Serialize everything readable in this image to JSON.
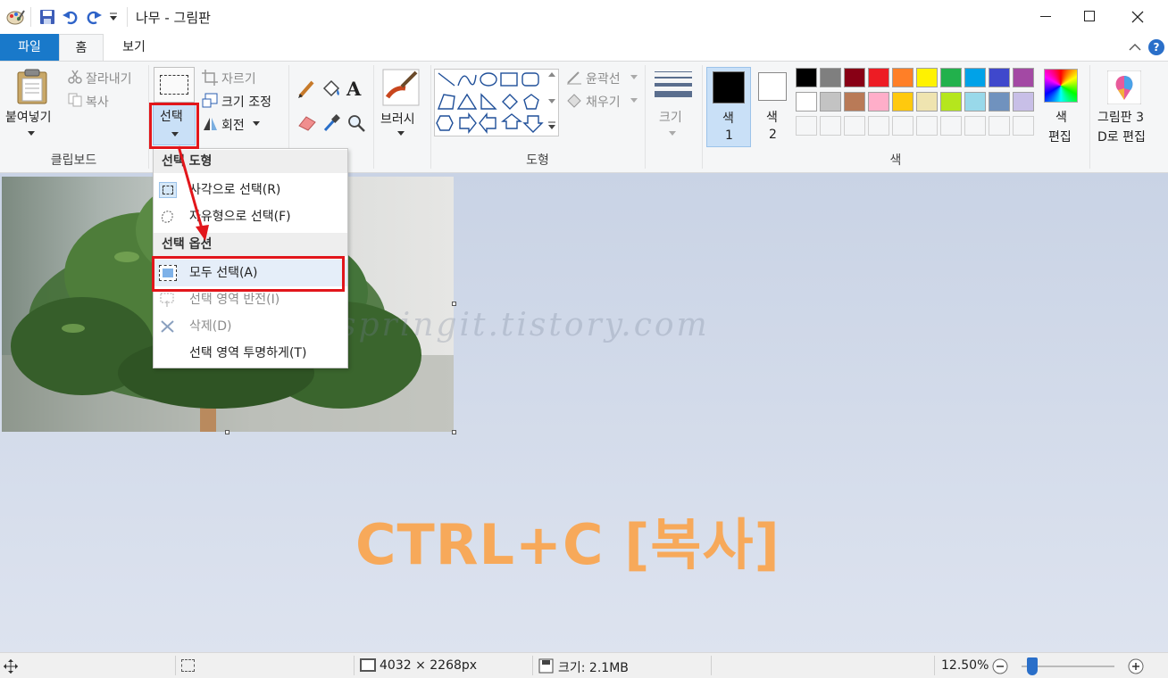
{
  "window": {
    "title": "나무 - 그림판",
    "controls": [
      "minimize",
      "maximize",
      "close"
    ]
  },
  "quick_access": [
    "save-icon",
    "undo-icon",
    "redo-icon",
    "customize-dropdown-icon"
  ],
  "tabs": {
    "file": "파일",
    "home": "홈",
    "view": "보기"
  },
  "ribbon": {
    "clipboard": {
      "paste": "붙여넣기",
      "cut": "잘라내기",
      "copy": "복사",
      "group": "클립보드"
    },
    "image": {
      "select": "선택",
      "crop": "자르기",
      "resize": "크기 조정",
      "rotate": "회전"
    },
    "tools": {
      "text_icon": "A"
    },
    "brushes": {
      "label": "브러시"
    },
    "shapes": {
      "outline": "윤곽선",
      "fill": "채우기",
      "group": "도형"
    },
    "size": {
      "label": "크기"
    },
    "colors": {
      "color1_a": "색",
      "color1_b": "1",
      "color2_a": "색",
      "color2_b": "2",
      "edit_a": "색",
      "edit_b": "편집",
      "group": "색",
      "palette_row1": [
        "#000000",
        "#7f7f7f",
        "#880015",
        "#ed1c24",
        "#ff7f27",
        "#fff200",
        "#22b14c",
        "#00a2e8",
        "#3f48cc",
        "#a349a4"
      ],
      "palette_row2": [
        "#ffffff",
        "#c3c3c3",
        "#b97a57",
        "#ffaec9",
        "#ffc90e",
        "#efe4b0",
        "#b5e61d",
        "#99d9ea",
        "#7092be",
        "#c8bfe7"
      ]
    },
    "paint3d": {
      "line1": "그림판 3",
      "line2": "D로 편집"
    }
  },
  "select_menu": {
    "header_shapes": "선택 도형",
    "rect_select": "사각으로 선택(R)",
    "free_select": "자유형으로 선택(F)",
    "header_options": "선택 옵션",
    "select_all": "모두 선택(A)",
    "invert": "선택 영역 반전(I)",
    "delete": "삭제(D)",
    "transparent": "선택 영역 투명하게(T)"
  },
  "statusbar": {
    "dimensions": "4032 × 2268px",
    "file_size": "크기: 2.1MB",
    "zoom": "12.50%",
    "zoom_level_fraction": 0.06
  },
  "overlay_text": "CTRL+C [복사]",
  "watermark": "springit.tistory.com"
}
